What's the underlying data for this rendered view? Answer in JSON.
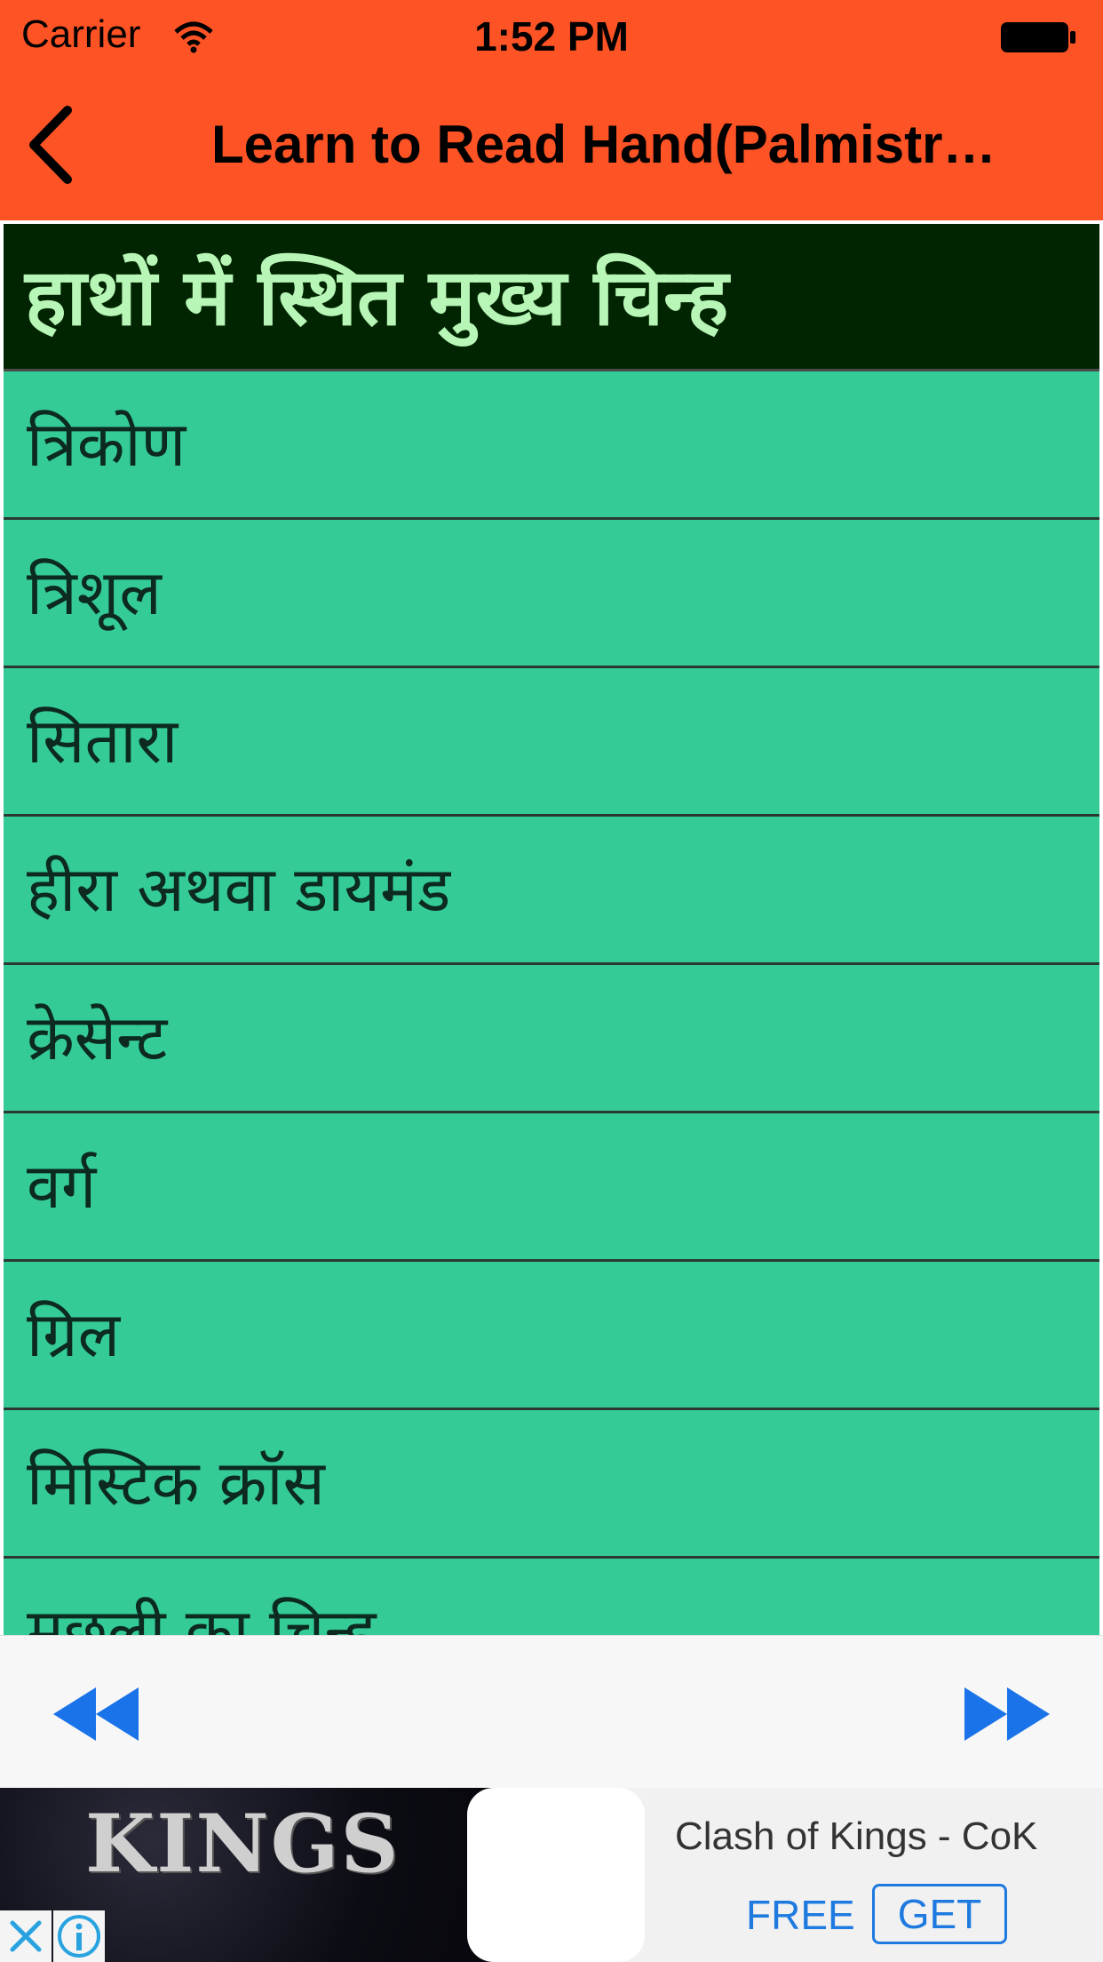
{
  "status_bar": {
    "carrier": "Carrier",
    "time": "1:52 PM"
  },
  "nav": {
    "title": "Learn to Read Hand(Palmistr…",
    "back_icon": "chevron-left-icon"
  },
  "list": {
    "header": "हाथों में स्थित मुख्य चिन्ह",
    "items": [
      "त्रिकोण",
      "त्रिशूल",
      "सितारा",
      "हीरा अथवा डायमंड",
      "क्रेसेन्ट",
      "वर्ग",
      "ग्रिल",
      "मिस्टिक क्रॉस",
      "मछली का चिन्ह"
    ]
  },
  "toolbar": {
    "rewind_icon": "rewind-icon",
    "forward_icon": "fast-forward-icon"
  },
  "ad": {
    "image_text": "KINGS",
    "title": "Clash of Kings - CoK",
    "free_label": "FREE",
    "get_label": "GET"
  },
  "colors": {
    "nav_bg": "#FE5325",
    "header_bg": "#002500",
    "header_text": "#B7F6B7",
    "row_bg": "#34CB97",
    "accent_blue": "#1F7AE0"
  }
}
